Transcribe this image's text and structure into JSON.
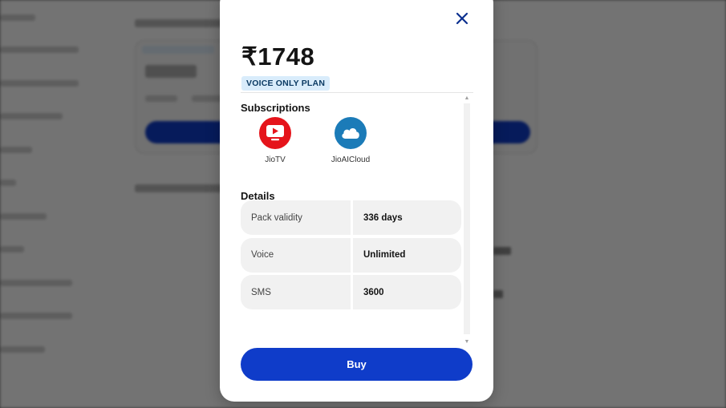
{
  "modal": {
    "price": "₹1748",
    "plan_badge": "VOICE ONLY PLAN",
    "subscriptions_title": "Subscriptions",
    "subscriptions": [
      {
        "label": "JioTV",
        "icon": "jiotv-icon",
        "color": "#e5141b"
      },
      {
        "label": "JioAICloud",
        "icon": "jioaicloud-icon",
        "color": "#1b7bb8"
      }
    ],
    "details_title": "Details",
    "details": [
      {
        "label": "Pack validity",
        "value": "336 days"
      },
      {
        "label": "Voice",
        "value": "Unlimited"
      },
      {
        "label": "SMS",
        "value": "3600"
      }
    ],
    "buy_label": "Buy",
    "close_icon": "close-icon"
  },
  "colors": {
    "accent": "#0f3cc9",
    "badge_bg": "#d9ecfb",
    "close_icon": "#0b2f8f"
  }
}
